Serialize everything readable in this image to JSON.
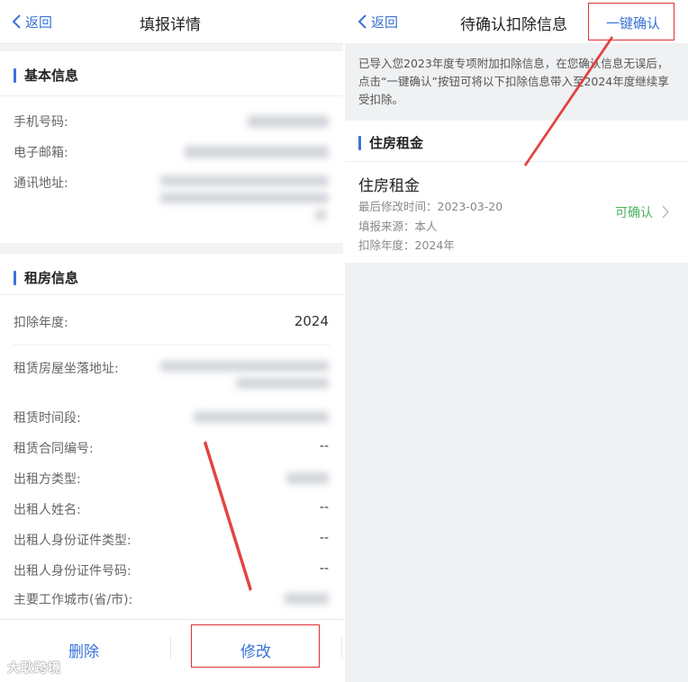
{
  "left": {
    "nav": {
      "back_label": "返回",
      "title": "填报详情"
    },
    "basic_info": {
      "header": "基本信息",
      "rows": [
        {
          "label": "手机号码:"
        },
        {
          "label": "电子邮箱:"
        },
        {
          "label": "通讯地址:"
        }
      ]
    },
    "rental_info": {
      "header": "租房信息",
      "rows": [
        {
          "label": "扣除年度:",
          "value": "2024"
        },
        {
          "label": "租赁房屋坐落地址:"
        },
        {
          "label": "租赁时间段:"
        },
        {
          "label": "租赁合同编号:",
          "value": "--"
        },
        {
          "label": "出租方类型:"
        },
        {
          "label": "出租人姓名:",
          "value": "--"
        },
        {
          "label": "出租人身份证件类型:",
          "value": "--"
        },
        {
          "label": "出租人身份证件号码:",
          "value": "--"
        },
        {
          "label": "主要工作城市(省/市):"
        }
      ]
    },
    "bottom": {
      "delete_label": "删除",
      "modify_label": "修改"
    },
    "watermark": "大耿跨境"
  },
  "right": {
    "nav": {
      "back_label": "返回",
      "title": "待确认扣除信息",
      "confirm_all_label": "一键确认"
    },
    "notice": "已导入您2023年度专项附加扣除信息，在您确认信息无误后，点击“一键确认”按钮可将以下扣除信息带入至2024年度继续享受扣除。",
    "section_header": "住房租金",
    "card": {
      "title": "住房租金",
      "last_modified": "最后修改时间：2023-03-20",
      "source": "填报来源：本人",
      "year": "扣除年度：2024年",
      "status": "可确认"
    }
  },
  "colors": {
    "accent": "#3a72d8",
    "section_bar": "#3b73d9",
    "confirm_green": "#4cb35e",
    "annotation_red": "#e0302e"
  },
  "icons": [
    "chevron-left-icon",
    "chevron-right-icon"
  ]
}
